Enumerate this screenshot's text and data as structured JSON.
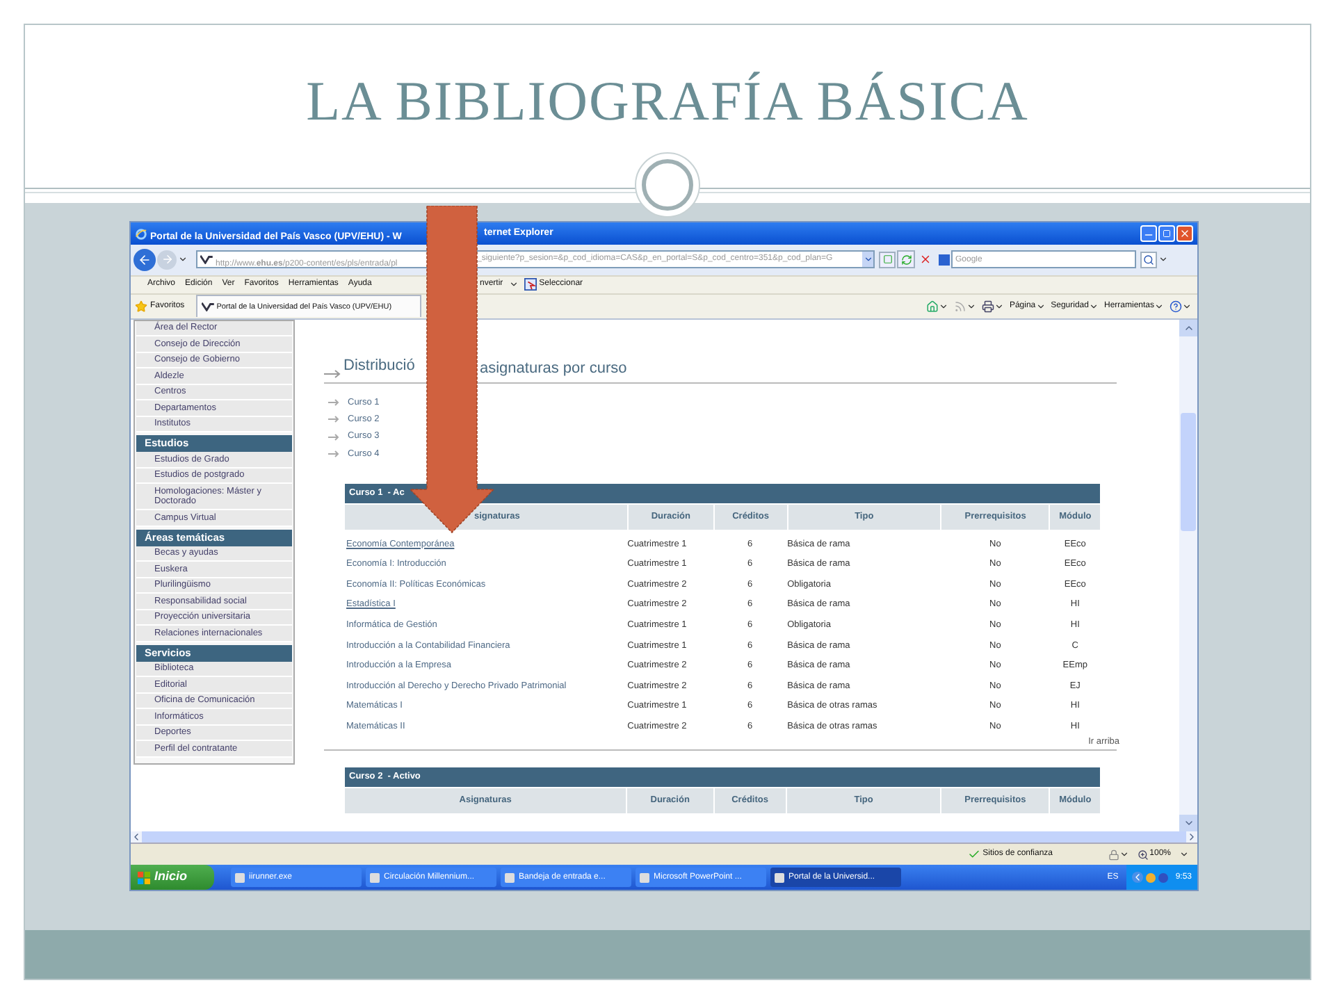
{
  "slide": {
    "title": "LA BIBLIOGRAFÍA BÁSICA"
  },
  "browser": {
    "title_left": "Portal de la Universidad del País Vasco (UPV/EHU) - W",
    "title_right": "ternet Explorer",
    "address_left": "http://www.**ehu.es**/p200-content/es/pls/entrada/pl",
    "address_right": "_siguiente?p_sesion=&p_cod_idioma=CAS&p_en_portal=S&p_cod_centro=351&p_cod_plan=G",
    "search_placeholder": "Google",
    "menu": [
      "Archivo",
      "Edición",
      "Ver",
      "Favoritos",
      "Herramientas",
      "Ayuda"
    ],
    "convert_label": "nvertir",
    "select_label": "Seleccionar",
    "favorites_label": "Favoritos",
    "favorite_tab": "Portal de la Universidad del País Vasco (UPV/EHU)",
    "command_bar": [
      "Página",
      "Seguridad",
      "Herramientas"
    ]
  },
  "sidebar": [
    {
      "items": [
        "Área del Rector",
        "Consejo de Dirección",
        "Consejo de Gobierno",
        "Aldezle",
        "Centros",
        "Departamentos",
        "Institutos"
      ]
    },
    {
      "heading": "Estudios",
      "items": [
        "Estudios de Grado",
        "Estudios de postgrado",
        "Homologaciones: Máster y Doctorado",
        "Campus Virtual"
      ]
    },
    {
      "heading": "Áreas temáticas",
      "items": [
        "Becas y ayudas",
        "Euskera",
        "Plurilingüismo",
        "Responsabilidad social",
        "Proyección universitaria",
        "Relaciones internacionales"
      ]
    },
    {
      "heading": "Servicios",
      "items": [
        "Biblioteca",
        "Editorial",
        "Oficina de Comunicación",
        "Informáticos",
        "Deportes",
        "Perfil del contratante"
      ]
    }
  ],
  "page": {
    "heading_left": "Distribució",
    "heading_right": "asignaturas por curso",
    "course_links": [
      "Curso 1",
      "Curso 2",
      "Curso 3",
      "Curso 4"
    ],
    "tables": [
      {
        "caption": "Curso 1  - Ac",
        "columns": [
          "signaturas",
          "Duración",
          "Créditos",
          "Tipo",
          "Prerrequisitos",
          "Módulo"
        ],
        "rows": [
          {
            "name": "Economía Contemporánea",
            "underlined": true,
            "duration": "Cuatrimestre 1",
            "credits": "6",
            "type": "Básica de rama",
            "prereq": "No",
            "module": "EEco"
          },
          {
            "name": "Economía I: Introducción",
            "underlined": false,
            "duration": "Cuatrimestre 1",
            "credits": "6",
            "type": "Básica de rama",
            "prereq": "No",
            "module": "EEco"
          },
          {
            "name": "Economía II: Políticas Económicas",
            "underlined": false,
            "duration": "Cuatrimestre 2",
            "credits": "6",
            "type": "Obligatoria",
            "prereq": "No",
            "module": "EEco"
          },
          {
            "name": "Estadística I",
            "underlined": true,
            "duration": "Cuatrimestre 2",
            "credits": "6",
            "type": "Básica de rama",
            "prereq": "No",
            "module": "HI"
          },
          {
            "name": "Informática de Gestión",
            "underlined": false,
            "duration": "Cuatrimestre 1",
            "credits": "6",
            "type": "Obligatoria",
            "prereq": "No",
            "module": "HI"
          },
          {
            "name": "Introducción a la Contabilidad Financiera",
            "underlined": false,
            "duration": "Cuatrimestre 1",
            "credits": "6",
            "type": "Básica de rama",
            "prereq": "No",
            "module": "C"
          },
          {
            "name": "Introducción a la Empresa",
            "underlined": false,
            "duration": "Cuatrimestre 2",
            "credits": "6",
            "type": "Básica de rama",
            "prereq": "No",
            "module": "EEmp"
          },
          {
            "name": "Introducción al Derecho y Derecho Privado Patrimonial",
            "underlined": false,
            "duration": "Cuatrimestre 2",
            "credits": "6",
            "type": "Básica de rama",
            "prereq": "No",
            "module": "EJ"
          },
          {
            "name": "Matemáticas I",
            "underlined": false,
            "duration": "Cuatrimestre 1",
            "credits": "6",
            "type": "Básica de otras ramas",
            "prereq": "No",
            "module": "HI"
          },
          {
            "name": "Matemáticas II",
            "underlined": false,
            "duration": "Cuatrimestre 2",
            "credits": "6",
            "type": "Básica de otras ramas",
            "prereq": "No",
            "module": "HI"
          }
        ]
      },
      {
        "caption": "Curso 2  - Activo",
        "columns": [
          "Asignaturas",
          "Duración",
          "Créditos",
          "Tipo",
          "Prerrequisitos",
          "Módulo"
        ]
      }
    ],
    "back_to_top": "Ir arriba"
  },
  "status_bar": {
    "zone": "Sitios de confianza",
    "zoom": "100%"
  },
  "taskbar": {
    "start": "Inicio",
    "tasks": [
      {
        "label": "iirunner.exe",
        "selected": false
      },
      {
        "label": "Circulación Millennium...",
        "selected": false
      },
      {
        "label": "Bandeja de entrada e...",
        "selected": false
      },
      {
        "label": "Microsoft PowerPoint ...",
        "selected": false
      },
      {
        "label": "Portal de la Universid...",
        "selected": true
      }
    ],
    "language": "ES",
    "clock": "9:53"
  }
}
